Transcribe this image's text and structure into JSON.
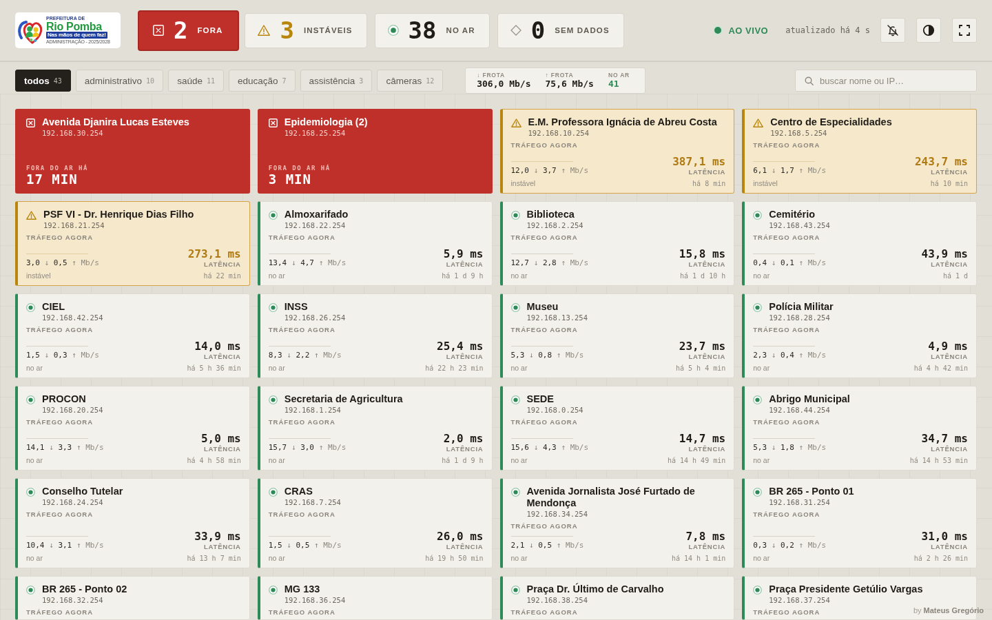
{
  "logo": {
    "top_line": "PREFEITURA DE",
    "name": "Rio Pomba",
    "slogan": "Nas mãos de quem faz!",
    "term": "ADMINISTRAÇÃO - 2025/2028"
  },
  "summary": [
    {
      "kind": "down",
      "count": "2",
      "label": "FORA"
    },
    {
      "kind": "unstable",
      "count": "3",
      "label": "INSTÁVEIS"
    },
    {
      "kind": "up",
      "count": "38",
      "label": "NO AR"
    },
    {
      "kind": "nodata",
      "count": "0",
      "label": "SEM DADOS"
    }
  ],
  "live": {
    "label": "AO VIVO",
    "updated": "atualizado há 4 s"
  },
  "filters": [
    {
      "label": "todos",
      "count": "43",
      "selected": true
    },
    {
      "label": "administrativo",
      "count": "10",
      "selected": false
    },
    {
      "label": "saúde",
      "count": "11",
      "selected": false
    },
    {
      "label": "educação",
      "count": "7",
      "selected": false
    },
    {
      "label": "assistência",
      "count": "3",
      "selected": false
    },
    {
      "label": "câmeras",
      "count": "12",
      "selected": false
    }
  ],
  "fleet": [
    {
      "kind": "rate",
      "label": "↓ FROTA",
      "value": "306,0 Mb/s"
    },
    {
      "kind": "rate",
      "label": "↑ FROTA",
      "value": "75,6 Mb/s"
    },
    {
      "kind": "count",
      "label": "NO AR",
      "value": "41"
    }
  ],
  "search": {
    "placeholder": "buscar nome ou IP…"
  },
  "devices": [
    {
      "kind": "down",
      "name": "Avenida Djanira Lucas Esteves",
      "ip": "192.168.30.254",
      "downtime_label": "FORA DO AR HÁ",
      "downtime": "17 MIN"
    },
    {
      "kind": "down",
      "name": "Epidemiologia (2)",
      "ip": "192.168.25.254",
      "downtime_label": "FORA DO AR HÁ",
      "downtime": "3 MIN"
    },
    {
      "kind": "unstable",
      "name": "E.M. Professora Ignácia de Abreu Costa",
      "ip": "192.168.10.254",
      "traffic_label": "TRÁFEGO AGORA",
      "traffic": "12,0 ↓ 3,7 ↑ Mb/s",
      "latency": "387,1 ms",
      "latency_label": "LATÊNCIA",
      "status": "instável",
      "since": "há 8 min"
    },
    {
      "kind": "unstable",
      "name": "Centro de Especialidades",
      "ip": "192.168.5.254",
      "traffic_label": "TRÁFEGO AGORA",
      "traffic": "6,1 ↓ 1,7 ↑ Mb/s",
      "latency": "243,7 ms",
      "latency_label": "LATÊNCIA",
      "status": "instável",
      "since": "há 10 min"
    },
    {
      "kind": "unstable",
      "name": "PSF VI - Dr. Henrique Dias Filho",
      "ip": "192.168.21.254",
      "traffic_label": "TRÁFEGO AGORA",
      "traffic": "3,0 ↓ 0,5 ↑ Mb/s",
      "latency": "273,1 ms",
      "latency_label": "LATÊNCIA",
      "status": "instável",
      "since": "há 22 min"
    },
    {
      "kind": "up",
      "name": "Almoxarifado",
      "ip": "192.168.22.254",
      "traffic_label": "TRÁFEGO AGORA",
      "traffic": "13,4 ↓ 4,7 ↑ Mb/s",
      "latency": "5,9 ms",
      "latency_label": "LATÊNCIA",
      "status": "no ar",
      "since": "há 1 d 9 h"
    },
    {
      "kind": "up",
      "name": "Biblioteca",
      "ip": "192.168.2.254",
      "traffic_label": "TRÁFEGO AGORA",
      "traffic": "12,7 ↓ 2,8 ↑ Mb/s",
      "latency": "15,8 ms",
      "latency_label": "LATÊNCIA",
      "status": "no ar",
      "since": "há 1 d 10 h"
    },
    {
      "kind": "up",
      "name": "Cemitério",
      "ip": "192.168.43.254",
      "traffic_label": "TRÁFEGO AGORA",
      "traffic": "0,4 ↓ 0,1 ↑ Mb/s",
      "latency": "43,9 ms",
      "latency_label": "LATÊNCIA",
      "status": "no ar",
      "since": "há 1 d"
    },
    {
      "kind": "up",
      "name": "CIEL",
      "ip": "192.168.42.254",
      "traffic_label": "TRÁFEGO AGORA",
      "traffic": "1,5 ↓ 0,3 ↑ Mb/s",
      "latency": "14,0 ms",
      "latency_label": "LATÊNCIA",
      "status": "no ar",
      "since": "há 5 h 36 min"
    },
    {
      "kind": "up",
      "name": "INSS",
      "ip": "192.168.26.254",
      "traffic_label": "TRÁFEGO AGORA",
      "traffic": "8,3 ↓ 2,2 ↑ Mb/s",
      "latency": "25,4 ms",
      "latency_label": "LATÊNCIA",
      "status": "no ar",
      "since": "há 22 h 23 min"
    },
    {
      "kind": "up",
      "name": "Museu",
      "ip": "192.168.13.254",
      "traffic_label": "TRÁFEGO AGORA",
      "traffic": "5,3 ↓ 0,8 ↑ Mb/s",
      "latency": "23,7 ms",
      "latency_label": "LATÊNCIA",
      "status": "no ar",
      "since": "há 5 h 4 min"
    },
    {
      "kind": "up",
      "name": "Polícia Militar",
      "ip": "192.168.28.254",
      "traffic_label": "TRÁFEGO AGORA",
      "traffic": "2,3 ↓ 0,4 ↑ Mb/s",
      "latency": "4,9 ms",
      "latency_label": "LATÊNCIA",
      "status": "no ar",
      "since": "há 4 h 42 min"
    },
    {
      "kind": "up",
      "name": "PROCON",
      "ip": "192.168.20.254",
      "traffic_label": "TRÁFEGO AGORA",
      "traffic": "14,1 ↓ 3,3 ↑ Mb/s",
      "latency": "5,0 ms",
      "latency_label": "LATÊNCIA",
      "status": "no ar",
      "since": "há 4 h 58 min"
    },
    {
      "kind": "up",
      "name": "Secretaria de Agricultura",
      "ip": "192.168.1.254",
      "traffic_label": "TRÁFEGO AGORA",
      "traffic": "15,7 ↓ 3,0 ↑ Mb/s",
      "latency": "2,0 ms",
      "latency_label": "LATÊNCIA",
      "status": "no ar",
      "since": "há 1 d 9 h"
    },
    {
      "kind": "up",
      "name": "SEDE",
      "ip": "192.168.0.254",
      "traffic_label": "TRÁFEGO AGORA",
      "traffic": "15,6 ↓ 4,3 ↑ Mb/s",
      "latency": "14,7 ms",
      "latency_label": "LATÊNCIA",
      "status": "no ar",
      "since": "há 14 h 49 min"
    },
    {
      "kind": "up",
      "name": "Abrigo Municipal",
      "ip": "192.168.44.254",
      "traffic_label": "TRÁFEGO AGORA",
      "traffic": "5,3 ↓ 1,8 ↑ Mb/s",
      "latency": "34,7 ms",
      "latency_label": "LATÊNCIA",
      "status": "no ar",
      "since": "há 14 h 53 min"
    },
    {
      "kind": "up",
      "name": "Conselho Tutelar",
      "ip": "192.168.24.254",
      "traffic_label": "TRÁFEGO AGORA",
      "traffic": "10,4 ↓ 3,1 ↑ Mb/s",
      "latency": "33,9 ms",
      "latency_label": "LATÊNCIA",
      "status": "no ar",
      "since": "há 13 h 7 min"
    },
    {
      "kind": "up",
      "name": "CRAS",
      "ip": "192.168.7.254",
      "traffic_label": "TRÁFEGO AGORA",
      "traffic": "1,5 ↓ 0,5 ↑ Mb/s",
      "latency": "26,0 ms",
      "latency_label": "LATÊNCIA",
      "status": "no ar",
      "since": "há 19 h 50 min"
    },
    {
      "kind": "up",
      "name": "Avenida Jornalista José Furtado de Mendonça",
      "ip": "192.168.34.254",
      "traffic_label": "TRÁFEGO AGORA",
      "traffic": "2,1 ↓ 0,5 ↑ Mb/s",
      "latency": "7,8 ms",
      "latency_label": "LATÊNCIA",
      "status": "no ar",
      "since": "há 14 h 1 min"
    },
    {
      "kind": "up",
      "name": "BR 265 - Ponto 01",
      "ip": "192.168.31.254",
      "traffic_label": "TRÁFEGO AGORA",
      "traffic": "0,3 ↓ 0,2 ↑ Mb/s",
      "latency": "31,0 ms",
      "latency_label": "LATÊNCIA",
      "status": "no ar",
      "since": "há 2 h 26 min"
    },
    {
      "kind": "up",
      "name": "BR 265 - Ponto 02",
      "ip": "192.168.32.254",
      "traffic_label": "TRÁFEGO AGORA"
    },
    {
      "kind": "up",
      "name": "MG 133",
      "ip": "192.168.36.254",
      "traffic_label": "TRÁFEGO AGORA"
    },
    {
      "kind": "up",
      "name": "Praça Dr. Último de Carvalho",
      "ip": "192.168.38.254",
      "traffic_label": "TRÁFEGO AGORA"
    },
    {
      "kind": "up",
      "name": "Praça Presidente Getúlio Vargas",
      "ip": "192.168.37.254",
      "traffic_label": "TRÁFEGO AGORA"
    }
  ],
  "credit": "by **Mateus Gregório**"
}
